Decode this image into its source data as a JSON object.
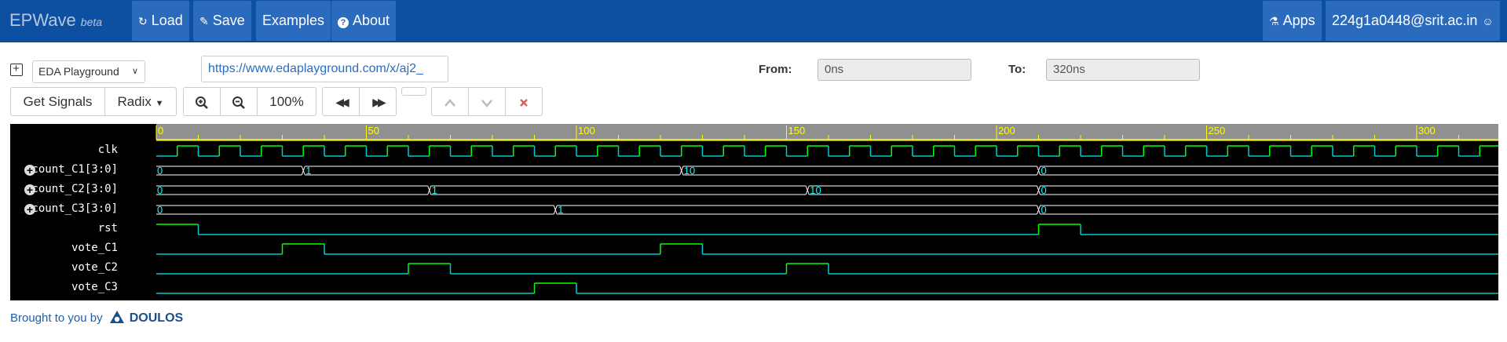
{
  "navbar": {
    "brand": "EPWave",
    "beta": "beta",
    "load": "Load",
    "save": "Save",
    "examples": "Examples",
    "about": "About",
    "apps": "Apps",
    "user": "224g1a0448@srit.ac.in"
  },
  "toolbar": {
    "playground_select": "EDA Playground",
    "url": "https://www.edaplayground.com/x/aj2_",
    "from_label": "From:",
    "from_value": "0ns",
    "to_label": "To:",
    "to_value": "320ns",
    "get_signals": "Get Signals",
    "radix": "Radix",
    "zoom_level": "100%"
  },
  "timeline": {
    "start": 0,
    "end": 320,
    "ticks": [
      "0",
      "50",
      "100",
      "150",
      "200",
      "250",
      "300"
    ]
  },
  "signals": [
    {
      "name": "clk",
      "type": "clock",
      "period": 10,
      "first_rise": 5,
      "expandable": false
    },
    {
      "name": "count_C1[3:0]",
      "type": "bus",
      "expandable": true,
      "segments": [
        {
          "t": 0,
          "v": "0"
        },
        {
          "t": 35,
          "v": "1"
        },
        {
          "t": 125,
          "v": "10"
        },
        {
          "t": 210,
          "v": "0"
        }
      ]
    },
    {
      "name": "count_C2[3:0]",
      "type": "bus",
      "expandable": true,
      "segments": [
        {
          "t": 0,
          "v": "0"
        },
        {
          "t": 65,
          "v": "1"
        },
        {
          "t": 155,
          "v": "10"
        },
        {
          "t": 210,
          "v": "0"
        }
      ]
    },
    {
      "name": "count_C3[3:0]",
      "type": "bus",
      "expandable": true,
      "segments": [
        {
          "t": 0,
          "v": "0"
        },
        {
          "t": 95,
          "v": "1"
        },
        {
          "t": 210,
          "v": "0"
        }
      ]
    },
    {
      "name": "rst",
      "type": "bit",
      "expandable": false,
      "initial": 1,
      "changes": [
        10,
        210,
        220
      ]
    },
    {
      "name": "vote_C1",
      "type": "bit",
      "expandable": false,
      "initial": 0,
      "changes": [
        30,
        40,
        120,
        130
      ]
    },
    {
      "name": "vote_C2",
      "type": "bit",
      "expandable": false,
      "initial": 0,
      "changes": [
        60,
        70,
        150,
        160
      ]
    },
    {
      "name": "vote_C3",
      "type": "bit",
      "expandable": false,
      "initial": 0,
      "changes": [
        90,
        100
      ]
    }
  ],
  "footer": {
    "text": "Brought to you by",
    "logo": "DOULOS"
  },
  "colors": {
    "navbar": "#0d4fa0",
    "nav_button": "#2b6bbd",
    "wave_high": "#00ff00",
    "wave_low": "#00cccc",
    "timeline_axis": "#ffff00",
    "remove_icon": "#cc3333"
  },
  "icons": {
    "load": "refresh-icon",
    "save": "pencil-icon",
    "about": "question-icon",
    "apps": "flask-icon",
    "user": "user-icon",
    "add": "plus-square-icon",
    "zoom_in": "zoom-in-icon",
    "zoom_out": "zoom-out-icon",
    "prev": "fast-backward-icon",
    "next": "fast-forward-icon",
    "up": "chevron-up-icon",
    "down": "chevron-down-icon",
    "remove": "close-icon"
  }
}
